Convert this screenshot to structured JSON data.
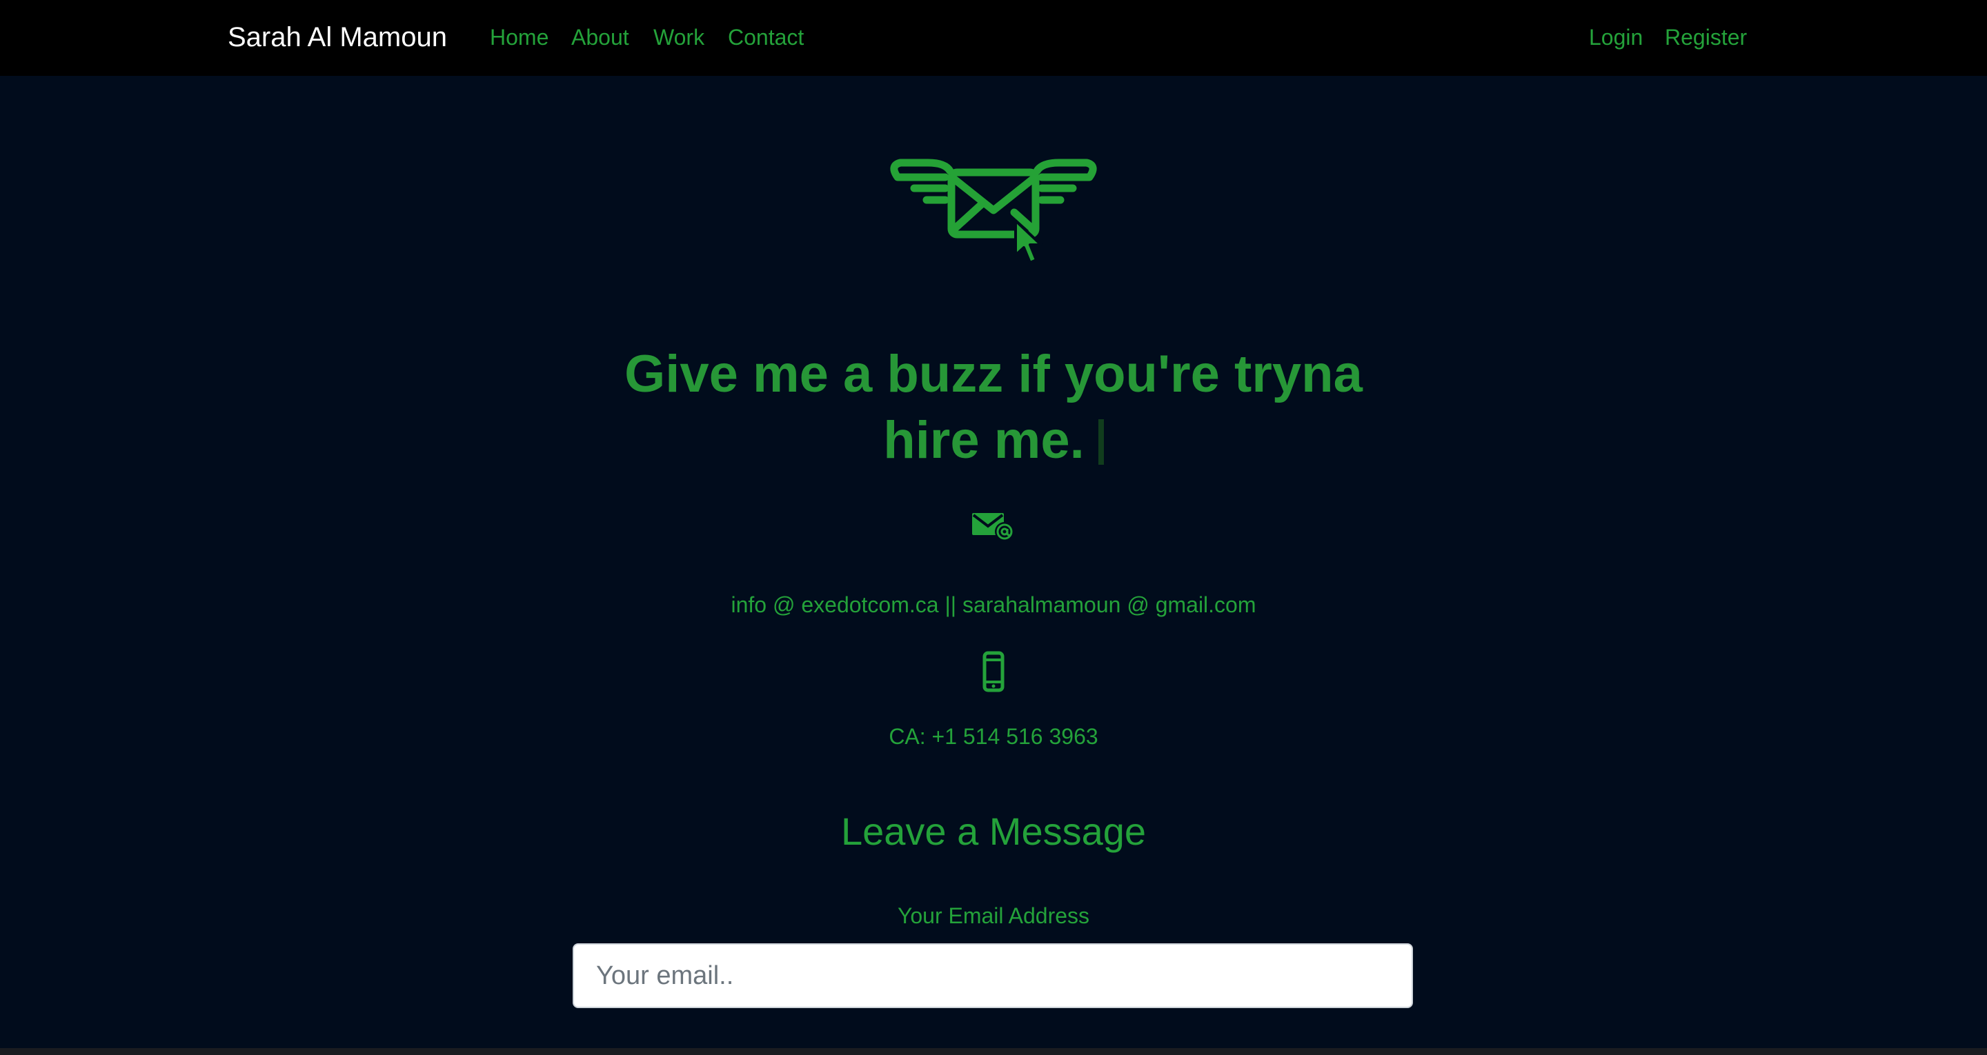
{
  "nav": {
    "brand": "Sarah Al Mamoun",
    "links": [
      "Home",
      "About",
      "Work",
      "Contact"
    ],
    "login": "Login",
    "register": "Register"
  },
  "hero": {
    "icon": "winged-envelope-icon",
    "headline_line1": "Give me a buzz if you're tryna",
    "headline_line2": "hire me."
  },
  "contact": {
    "email_icon": "email-at-icon",
    "emails": "info @ exedotcom.ca || sarahalmamoun @ gmail.com",
    "phone_icon": "mobile-phone-icon",
    "phone": "CA: +1 514 516 3963"
  },
  "form": {
    "title": "Leave a Message",
    "email_label": "Your Email Address",
    "email_placeholder": "Your email..",
    "email_value": ""
  },
  "colors": {
    "background": "#010c1c",
    "navbar": "#000000",
    "accent": "#24a23a"
  }
}
